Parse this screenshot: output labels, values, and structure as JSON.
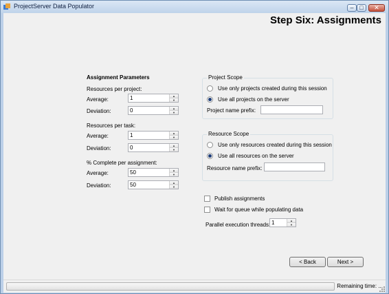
{
  "window": {
    "title": "ProjectServer Data Populator",
    "min_glyph": "–",
    "max_glyph": "□",
    "close_glyph": "✕"
  },
  "page": {
    "heading": "Step Six: Assignments"
  },
  "params": {
    "heading": "Assignment Parameters",
    "resources_per_project": {
      "label": "Resources per project:",
      "average_label": "Average:",
      "average_value": "1",
      "deviation_label": "Deviation:",
      "deviation_value": "0"
    },
    "resources_per_task": {
      "label": "Resources per task:",
      "average_label": "Average:",
      "average_value": "1",
      "deviation_label": "Deviation:",
      "deviation_value": "0"
    },
    "percent_complete": {
      "label": "% Complete per assignment:",
      "average_label": "Average:",
      "average_value": "50",
      "deviation_label": "Deviation:",
      "deviation_value": "50"
    }
  },
  "project_scope": {
    "title": "Project Scope",
    "option_session": "Use only projects created during this session",
    "option_all": "Use all projects on the server",
    "selected": "all",
    "prefix_label": "Project name prefix:",
    "prefix_value": ""
  },
  "resource_scope": {
    "title": "Resource Scope",
    "option_session": "Use only resources created during this session",
    "option_all": "Use all resources on the server",
    "selected": "all",
    "prefix_label": "Resource name prefix:",
    "prefix_value": ""
  },
  "options": {
    "publish_label": "Publish assignments",
    "publish_checked": false,
    "wait_label": "Wait for queue while populating data",
    "wait_checked": false,
    "threads_label": "Parallel execution threads:",
    "threads_value": "1"
  },
  "nav": {
    "back_label": "< Back",
    "next_label": "Next >"
  },
  "status": {
    "text": "Remaining time: ...",
    "progress_fraction": 0
  },
  "colors": {
    "title_bar": "#bfd3ea",
    "background": "#f0f0f0",
    "close_button": "#c5513c"
  },
  "icons": {
    "app": "app-icon",
    "spin_up": "chevron-up-icon",
    "spin_down": "chevron-down-icon"
  }
}
